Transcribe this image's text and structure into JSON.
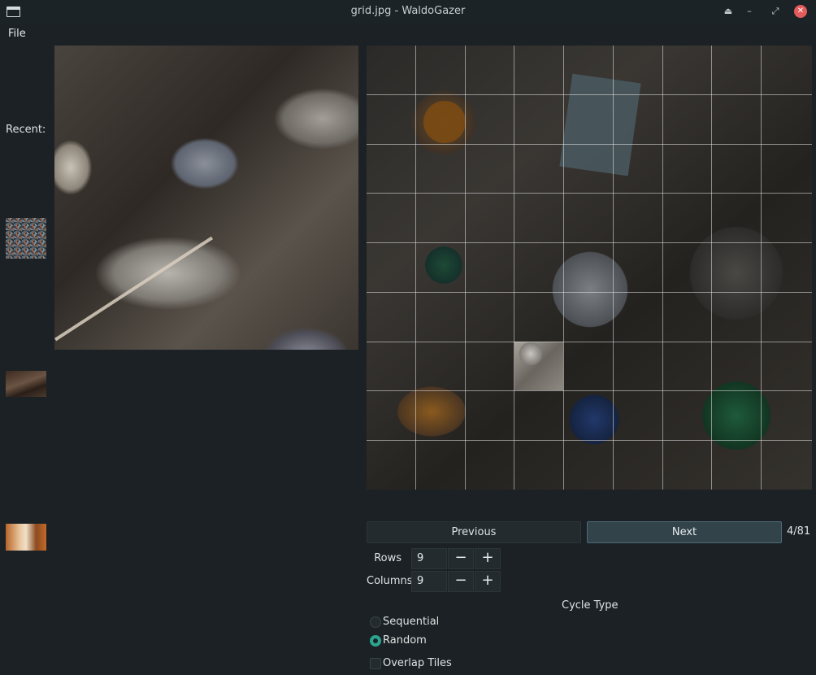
{
  "window": {
    "title": "grid.jpg - WaldoGazer",
    "controls": [
      "eject-icon",
      "minimize-icon",
      "restore-icon",
      "close-icon"
    ]
  },
  "menu": {
    "file": "File"
  },
  "sidebar": {
    "recent_label": "Recent:",
    "thumbnails": [
      "recent-thumbnail-1",
      "recent-thumbnail-2",
      "recent-thumbnail-3"
    ]
  },
  "navigation": {
    "previous": "Previous",
    "next": "Next",
    "counter": "4/81"
  },
  "grid_settings": {
    "rows_label": "Rows",
    "rows_value": "9",
    "columns_label": "Columns",
    "columns_value": "9"
  },
  "cycle": {
    "label": "Cycle Type",
    "options": [
      "Sequential",
      "Random"
    ],
    "selected": "Random"
  },
  "overlap": {
    "label": "Overlap Tiles",
    "checked": false
  },
  "colors": {
    "accent": "#2aa58f",
    "close": "#e35b5b",
    "background": "#1b2124"
  }
}
